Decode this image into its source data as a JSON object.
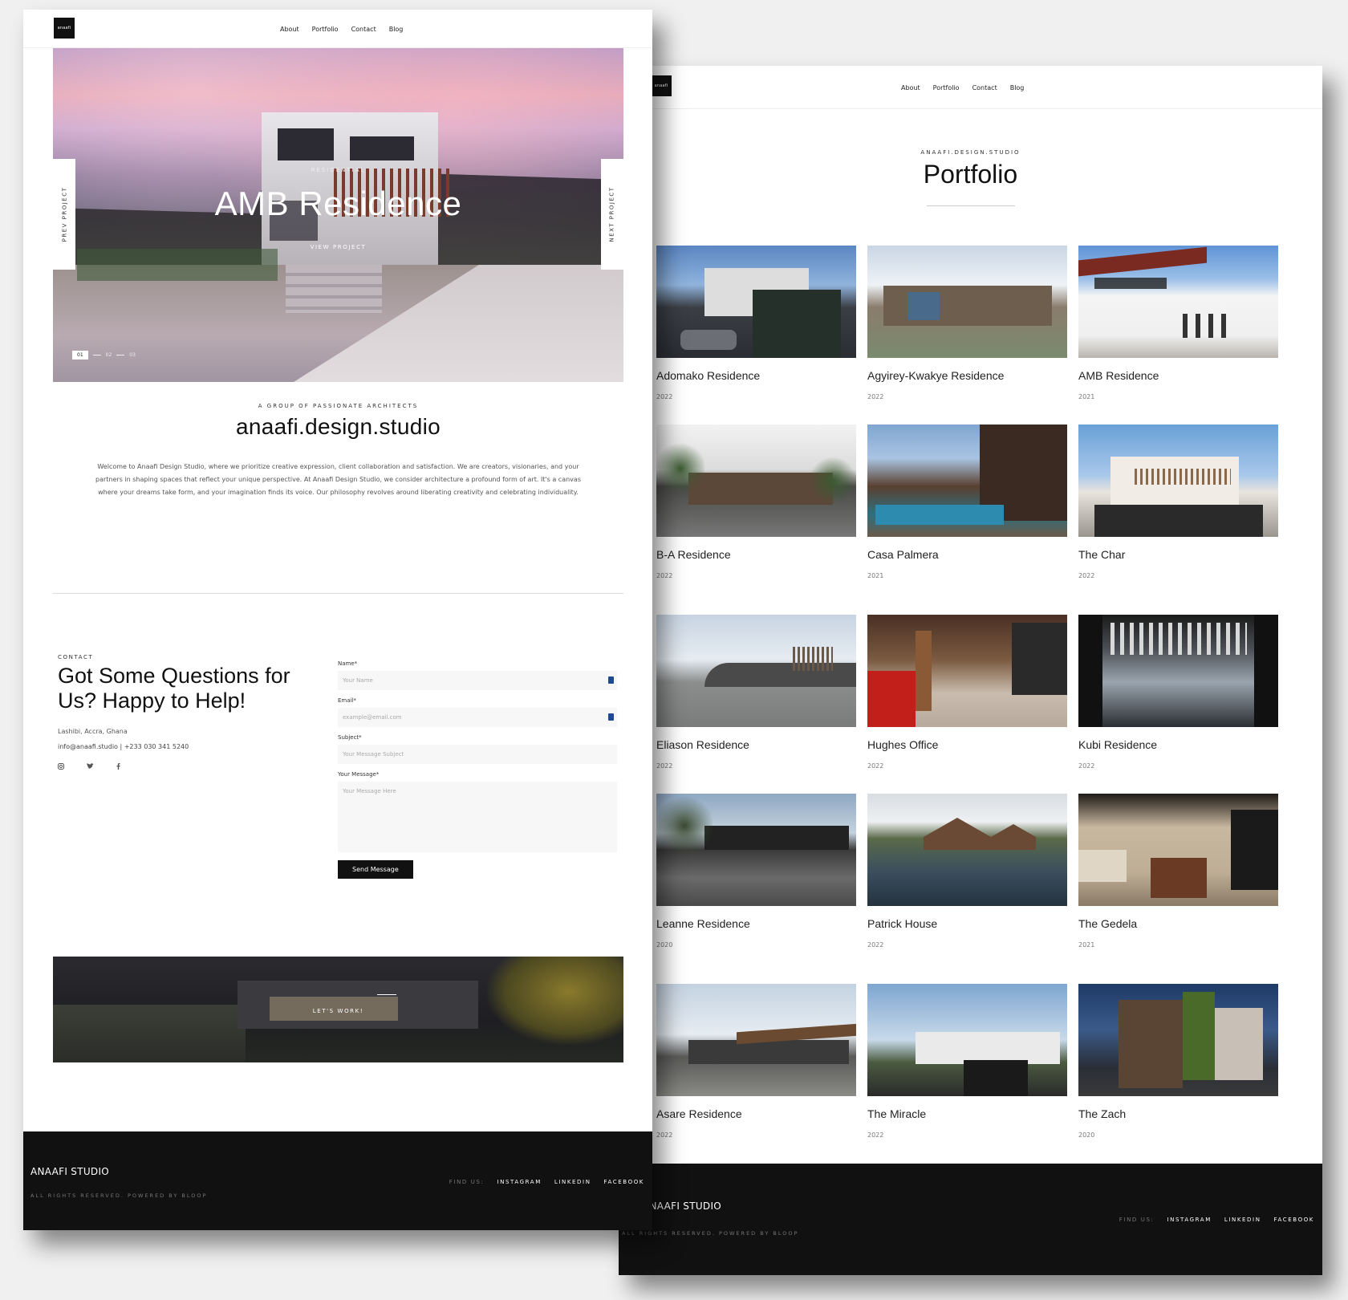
{
  "front": {
    "logo_text": "anaafi",
    "nav": [
      "About",
      "Portfolio",
      "Contact",
      "Blog"
    ],
    "hero": {
      "kicker": "RESIDENTIAL",
      "title": "AMB Residence",
      "view_project": "VIEW PROJECT",
      "prev": "PREV PROJECT",
      "next": "NEXT PROJECT",
      "pager": [
        "01",
        "02",
        "03"
      ]
    },
    "about": {
      "kicker": "A GROUP OF PASSIONATE ARCHITECTS",
      "title": "anaafi.design.studio",
      "body": "Welcome to Anaafi Design Studio, where we prioritize creative expression, client collaboration and satisfaction. We are creators, visionaries, and your partners in shaping spaces that reflect your unique perspective. At Anaafi Design Studio, we consider architecture a profound form of art. It's a canvas where your dreams take form, and your imagination finds its voice. Our philosophy revolves around liberating creativity and celebrating individuality."
    },
    "contact": {
      "kicker": "CONTACT",
      "heading": "Got Some Questions for Us? Happy to Help!",
      "address": "Lashibi, Accra, Ghana",
      "email_phone": "info@anaafi.studio  |  +233 030 341 5240",
      "socials": [
        "instagram-icon",
        "twitter-icon",
        "facebook-icon"
      ]
    },
    "form": {
      "name_label": "Name*",
      "name_placeholder": "Your Name",
      "email_label": "Email*",
      "email_placeholder": "example@email.com",
      "subject_label": "Subject*",
      "subject_placeholder": "Your Message Subject",
      "message_label": "Your Message*",
      "message_placeholder": "Your Message Here",
      "submit": "Send Message"
    },
    "cta": {
      "label": "LET'S WORK!"
    },
    "footer": {
      "brand": "ANAAFI STUDIO",
      "rights": "ALL RIGHTS RESERVED. POWERED BY BLOOP",
      "find_us": "FIND US:",
      "links": [
        "INSTAGRAM",
        "LINKEDIN",
        "FACEBOOK"
      ]
    }
  },
  "portfolio": {
    "logo_text": "anaafi",
    "nav": [
      "About",
      "Portfolio",
      "Contact",
      "Blog"
    ],
    "kicker": "ANAAFI.DESIGN.STUDIO",
    "title": "Portfolio",
    "projects": [
      {
        "name": "Adomako Residence",
        "year": "2022"
      },
      {
        "name": "Agyirey-Kwakye Residence",
        "year": "2022"
      },
      {
        "name": "AMB Residence",
        "year": "2021"
      },
      {
        "name": "B-A Residence",
        "year": "2022"
      },
      {
        "name": "Casa Palmera",
        "year": "2021"
      },
      {
        "name": "The Char",
        "year": "2022"
      },
      {
        "name": "Eliason Residence",
        "year": "2022"
      },
      {
        "name": "Hughes Office",
        "year": "2022"
      },
      {
        "name": "Kubi Residence",
        "year": "2022"
      },
      {
        "name": "Leanne Residence",
        "year": "2020"
      },
      {
        "name": "Patrick House",
        "year": "2022"
      },
      {
        "name": "The Gedela",
        "year": "2021"
      },
      {
        "name": "Asare Residence",
        "year": "2022"
      },
      {
        "name": "The Miracle",
        "year": "2022"
      },
      {
        "name": "The Zach",
        "year": "2020"
      }
    ],
    "footer": {
      "brand": "ANAAFI STUDIO",
      "rights": "ALL RIGHTS RESERVED. POWERED BY BLOOP",
      "find_us": "FIND US:",
      "links": [
        "INSTAGRAM",
        "LINKEDIN",
        "FACEBOOK"
      ]
    }
  }
}
